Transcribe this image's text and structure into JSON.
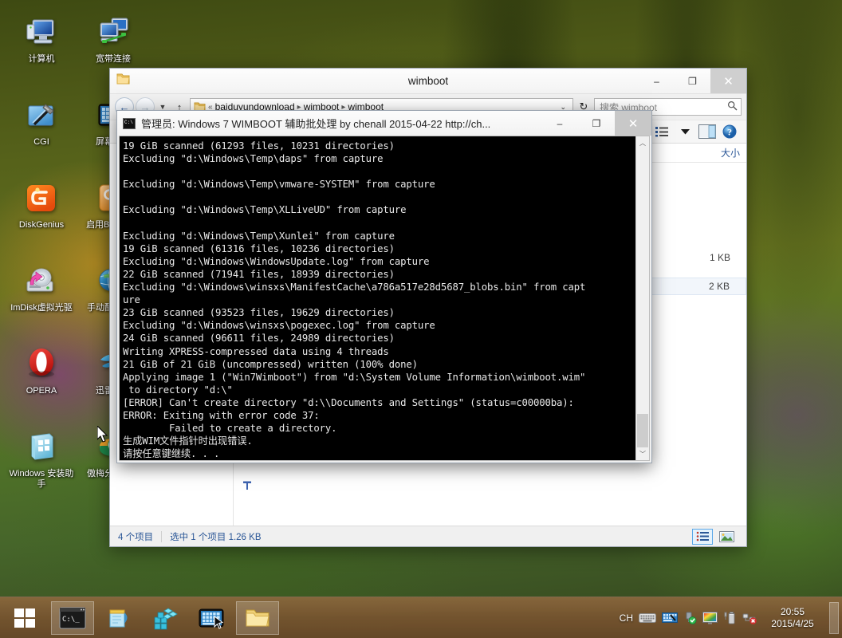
{
  "desktop": {
    "icons": [
      {
        "label": "计算机",
        "icon": "computer-icon"
      },
      {
        "label": "宽带连接",
        "icon": "broadband-connection-icon"
      },
      {
        "label": "CGI",
        "icon": "cgi-icon"
      },
      {
        "label": "屏幕键盘",
        "icon": "on-screen-keyboard-icon"
      },
      {
        "label": "DiskGenius",
        "icon": "diskgenius-icon"
      },
      {
        "label": "启用BitLocker",
        "icon": "bitlocker-icon"
      },
      {
        "label": "ImDisk虚拟光驱",
        "icon": "imdisk-virtual-drive-icon"
      },
      {
        "label": "手动配置网络",
        "icon": "network-config-icon"
      },
      {
        "label": "OPERA",
        "icon": "opera-icon"
      },
      {
        "label": "迅雷下载",
        "icon": "thunder-download-icon"
      },
      {
        "label": "Windows 安装助手",
        "icon": "windows-setup-assistant-icon"
      },
      {
        "label": "傲梅分区助手",
        "icon": "aomei-partition-assistant-icon"
      }
    ]
  },
  "explorer": {
    "title": "wimboot",
    "title_icon": "folder-icon",
    "window_buttons": {
      "minimize": "–",
      "maximize": "❐",
      "close": "✕"
    },
    "nav": {
      "back": "←",
      "forward": "→",
      "history_dropdown": "▼",
      "up": "↑",
      "address_prefix": "«",
      "breadcrumbs": [
        "baiduyundownload",
        "wimboot",
        "wimboot"
      ],
      "breadcrumb_separator": "▸",
      "address_dropdown": "⌄",
      "refresh": "↻"
    },
    "search": {
      "placeholder": "搜索 wimboot",
      "icon": "search-icon"
    },
    "toolbar": {
      "view_options_icon": "view-options-icon",
      "view_dropdown_icon": "chevron-down-icon",
      "preview_pane_icon": "preview-pane-icon",
      "help_icon": "help-icon"
    },
    "columns": {
      "size": "大小"
    },
    "files": [
      {
        "name": "",
        "size": "1 KB",
        "selected": false,
        "icon": "file-icon"
      },
      {
        "name": "",
        "size": "2 KB",
        "selected": true,
        "icon": "file-icon"
      }
    ],
    "status": {
      "item_count": "4 个项目",
      "selection": "选中 1 个项目  1.26 KB"
    },
    "view_buttons": {
      "details": "details-view-icon",
      "large_icons": "large-icons-view-icon"
    }
  },
  "console": {
    "title": "管理员: Windows 7 WIMBOOT 辅助批处理 by chenall 2015-04-22 http://ch...",
    "icon": "console-icon",
    "window_buttons": {
      "minimize": "–",
      "maximize": "❐",
      "close": "✕"
    },
    "scrollbar": {
      "up": "︿",
      "down": "﹀"
    },
    "output": "19 GiB scanned (61293 files, 10231 directories)\nExcluding \"d:\\Windows\\Temp\\daps\" from capture\n\nExcluding \"d:\\Windows\\Temp\\vmware-SYSTEM\" from capture\n\nExcluding \"d:\\Windows\\Temp\\XLLiveUD\" from capture\n\nExcluding \"d:\\Windows\\Temp\\Xunlei\" from capture\n19 GiB scanned (61316 files, 10236 directories)\nExcluding \"d:\\Windows\\WindowsUpdate.log\" from capture\n22 GiB scanned (71941 files, 18939 directories)\nExcluding \"d:\\Windows\\winsxs\\ManifestCache\\a786a517e28d5687_blobs.bin\" from capt\nure\n23 GiB scanned (93523 files, 19629 directories)\nExcluding \"d:\\Windows\\winsxs\\pogexec.log\" from capture\n24 GiB scanned (96611 files, 24989 directories)\nWriting XPRESS-compressed data using 4 threads\n21 GiB of 21 GiB (uncompressed) written (100% done)\nApplying image 1 (\"Win7Wimboot\") from \"d:\\System Volume Information\\wimboot.wim\"\n to directory \"d:\\\"\n[ERROR] Can't create directory \"d:\\\\Documents and Settings\" (status=c00000ba):\nERROR: Exiting with error code 37:\n        Failed to create a directory.\n生成WIM文件指针时出现错误.\n请按任意键继续. . ."
  },
  "taskbar": {
    "start": "start-button",
    "items": [
      {
        "name": "command-prompt-taskbar-item",
        "icon": "console-icon",
        "active": true
      },
      {
        "name": "notepad-taskbar-item",
        "icon": "notepad-icon",
        "active": false
      },
      {
        "name": "cube-app-taskbar-item",
        "icon": "cube-icon",
        "active": false
      },
      {
        "name": "onscreen-keyboard-taskbar-item",
        "icon": "keyboard-icon",
        "active": false
      },
      {
        "name": "explorer-taskbar-item",
        "icon": "folder-icon",
        "active": true
      }
    ],
    "tray": {
      "language": "CH",
      "icons": [
        "keyboard-tray-icon",
        "ime-pad-tray-icon",
        "usb-safely-remove-icon",
        "display-tray-icon",
        "battery-tray-icon",
        "network-error-tray-icon"
      ]
    },
    "clock": {
      "time": "20:55",
      "date": "2015/4/25"
    }
  },
  "colors": {
    "accent_blue": "#2b5797",
    "selection_blue": "#5ba8e8",
    "console_bg": "#000000",
    "console_fg": "#e8e8e8",
    "taskbar_brown": "#78542f"
  }
}
